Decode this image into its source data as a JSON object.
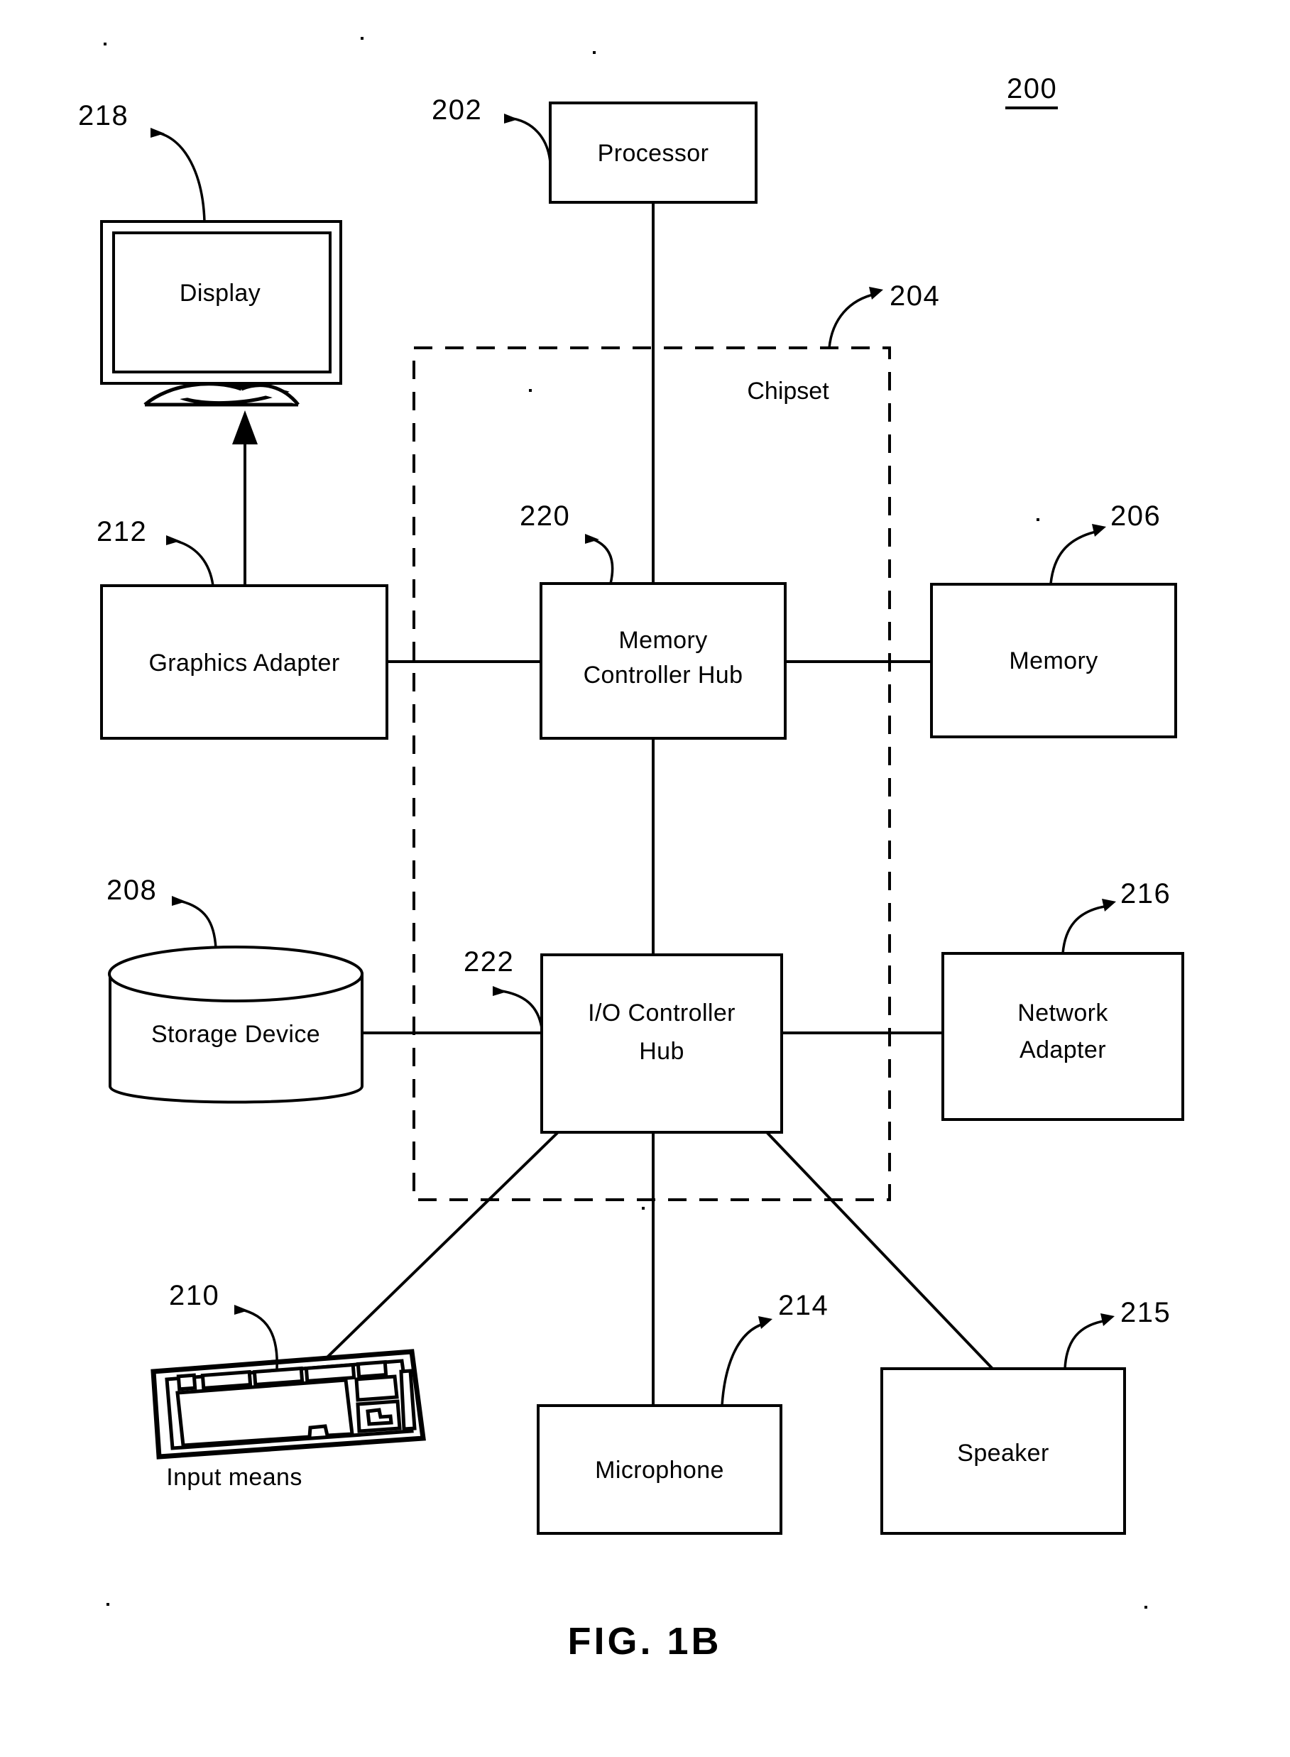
{
  "figure": {
    "caption": "FIG. 1B",
    "system_ref": "200"
  },
  "blocks": {
    "processor": {
      "label": "Processor",
      "ref": "202"
    },
    "chipset": {
      "label": "Chipset",
      "ref": "204"
    },
    "memory_controller_hub": {
      "label_line1": "Memory",
      "label_line2": "Controller Hub",
      "ref": "220"
    },
    "memory": {
      "label": "Memory",
      "ref": "206"
    },
    "graphics_adapter": {
      "label": "Graphics Adapter",
      "ref": "212"
    },
    "display": {
      "label": "Display",
      "ref": "218"
    },
    "storage_device": {
      "label": "Storage Device",
      "ref": "208"
    },
    "io_controller_hub": {
      "label_line1": "I/O Controller",
      "label_line2": "Hub",
      "ref": "222"
    },
    "network_adapter": {
      "label_line1": "Network",
      "label_line2": "Adapter",
      "ref": "216"
    },
    "input_means": {
      "label": "Input means",
      "ref": "210"
    },
    "microphone": {
      "label": "Microphone",
      "ref": "214"
    },
    "speaker": {
      "label": "Speaker",
      "ref": "215"
    }
  },
  "colors": {
    "ink": "#000000",
    "paper": "#ffffff"
  }
}
